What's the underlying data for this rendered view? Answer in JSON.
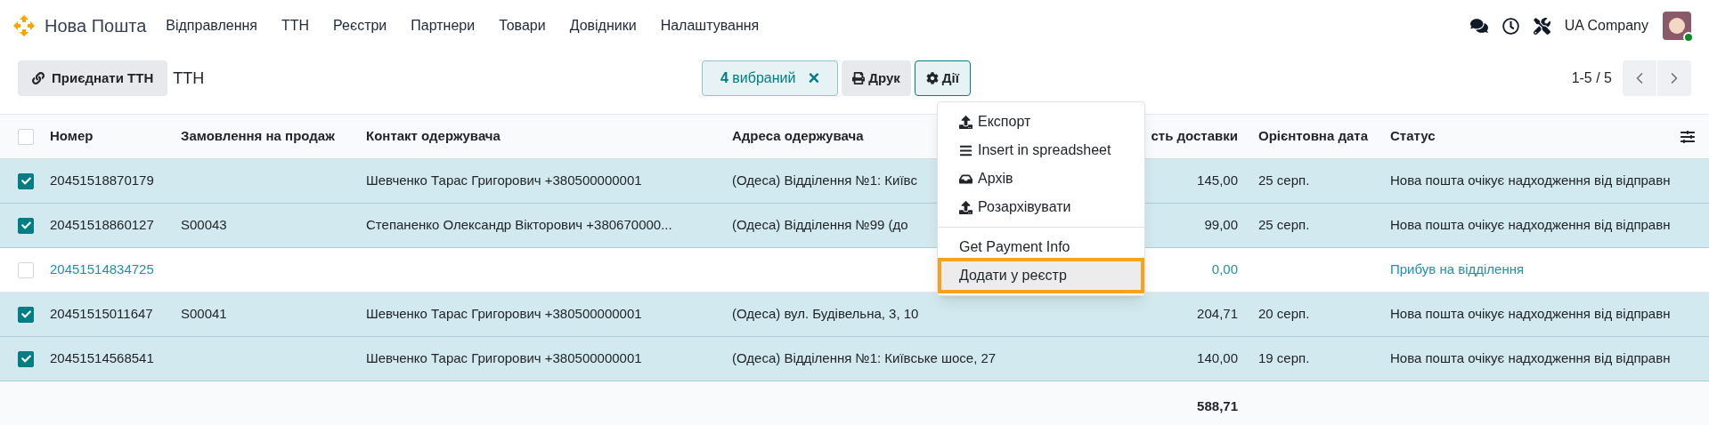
{
  "app": {
    "brand": "Нова Пошта",
    "nav": [
      "Відправлення",
      "ТТН",
      "Реєстри",
      "Партнери",
      "Товари",
      "Довідники",
      "Налаштування"
    ],
    "company": "UA Company",
    "online": true
  },
  "toolbar": {
    "attach_button": "Приєднати ТТН",
    "title": "ТТН",
    "selection": {
      "count": "4",
      "label": "вибраний",
      "clear": "×"
    },
    "print_button": "Друк",
    "actions_button": "Дії",
    "actions_open": true,
    "pager": "1-5 / 5"
  },
  "actions_menu": {
    "sections": [
      [
        {
          "label": "Експорт",
          "highlighted": false
        },
        {
          "label": "Insert in spreadsheet",
          "highlighted": false
        },
        {
          "label": "Архів",
          "highlighted": false
        },
        {
          "label": "Розархівувати",
          "highlighted": false
        }
      ],
      [
        {
          "label": "Get Payment Info",
          "highlighted": false
        },
        {
          "label": "Додати у реєстр",
          "highlighted": true
        }
      ]
    ]
  },
  "table": {
    "header_checked": false,
    "columns": [
      "Номер",
      "Замовлення на продаж",
      "Контакт одержувача",
      "Адреса одержувача",
      "сть доставки",
      "Орієнтовна дата",
      "Статус"
    ],
    "rows": [
      {
        "selected": true,
        "kind": "normal",
        "cells": [
          "20451518870179",
          "",
          "Шевченко Тарас Григорович +380500000001",
          "(Одеса) Відділення №1: Київс",
          "145,00",
          "25 серп.",
          "Нова пошта очікує надходження від відправн"
        ]
      },
      {
        "selected": true,
        "kind": "normal",
        "cells": [
          "20451518860127",
          "S00043",
          "Степаненко Олександр Вікторович +380670000...",
          "(Одеса) Відділення №99 (до",
          "99,00",
          "25 серп.",
          "Нова пошта очікує надходження від відправн"
        ]
      },
      {
        "selected": false,
        "kind": "info",
        "cells": [
          "20451514834725",
          "",
          "",
          "",
          "0,00",
          "",
          "Прибув на відділення"
        ]
      },
      {
        "selected": true,
        "kind": "normal",
        "cells": [
          "20451515011647",
          "S00041",
          "Шевченко Тарас Григорович +380500000001",
          "(Одеса) вул. Будівельна, 3, 10",
          "204,71",
          "20 серп.",
          "Нова пошта очікує надходження від відправн"
        ]
      },
      {
        "selected": true,
        "kind": "normal",
        "cells": [
          "20451514568541",
          "",
          "Шевченко Тарас Григорович +380500000001",
          "(Одеса) Відділення №1: Київське шосе, 27",
          "140,00",
          "19 серп.",
          "Нова пошта очікує надходження від відправн"
        ]
      }
    ],
    "total": "588,71"
  }
}
